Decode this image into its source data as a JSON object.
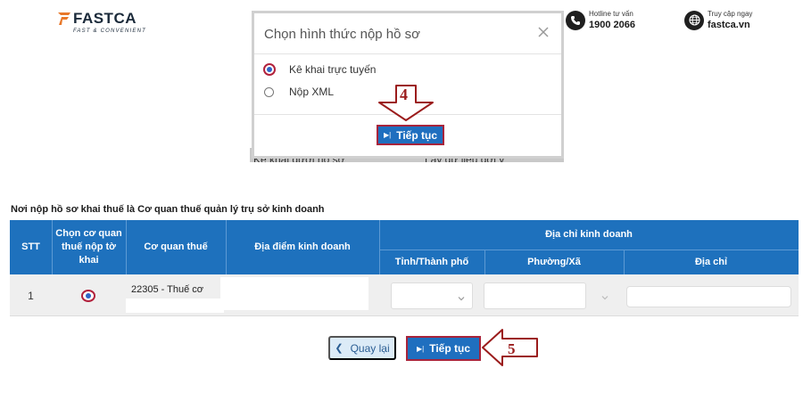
{
  "header": {
    "brand": "FASTCA",
    "tagline": "FAST & CONVENIENT",
    "hotline_label": "Hotline tư vấn",
    "hotline_number": "1900 2066",
    "web_label": "Truy cập ngay",
    "web_url": "fastca.vn",
    "icons": [
      "phone-icon",
      "globe-icon"
    ]
  },
  "background_peek": {
    "left_text": "Kê khai dưới hồ sơ",
    "right_text": "Lấy dữ liệu gợi ý"
  },
  "modal": {
    "title": "Chọn hình thức nộp hồ sơ",
    "options": [
      {
        "label": "Kê khai trực tuyến",
        "selected": true
      },
      {
        "label": "Nộp XML",
        "selected": false
      }
    ],
    "continue_label": "Tiếp tục",
    "icons": [
      "close-icon",
      "step-forward-icon"
    ]
  },
  "annotations": {
    "step4": "4",
    "step5": "5"
  },
  "section": {
    "title": "Nơi nộp hồ sơ khai thuế là Cơ quan thuế quản lý trụ sở kinh doanh"
  },
  "table": {
    "headers": {
      "stt": "STT",
      "choose": "Chọn cơ quan thuế nộp tờ khai",
      "agency": "Cơ quan thuế",
      "location": "Địa điểm kinh doanh",
      "business_address": "Địa chỉ kinh doanh",
      "province": "Tỉnh/Thành phố",
      "ward": "Phường/Xã",
      "address": "Địa chỉ"
    },
    "rows": [
      {
        "stt": "1",
        "selected": true,
        "agency": "22305 - Thuế cơ",
        "location": "",
        "province": "",
        "ward": "",
        "address": ""
      }
    ]
  },
  "footer": {
    "back_label": "Quay lại",
    "continue_label": "Tiếp tục"
  },
  "colors": {
    "primary": "#1f6fbf",
    "header_blue": "#1e71bd",
    "highlight_red": "#a8243b",
    "annotation_red": "#9b1c1c",
    "back_bg": "#dcebf7"
  }
}
